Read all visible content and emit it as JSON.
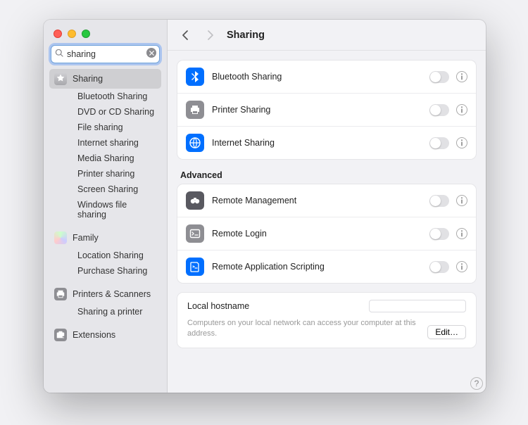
{
  "search": {
    "value": "sharing",
    "placeholder": "Search"
  },
  "sidebar": {
    "selected": "Sharing",
    "items": [
      "Bluetooth Sharing",
      "DVD or CD Sharing",
      "File sharing",
      "Internet sharing",
      "Media Sharing",
      "Printer sharing",
      "Screen Sharing",
      "Windows file sharing"
    ],
    "family": {
      "label": "Family",
      "items": [
        "Location Sharing",
        "Purchase Sharing"
      ]
    },
    "printers": {
      "label": "Printers & Scanners",
      "items": [
        "Sharing a printer"
      ]
    },
    "extensions": {
      "label": "Extensions"
    }
  },
  "main": {
    "title": "Sharing",
    "rows": [
      {
        "label": "Bluetooth Sharing",
        "icon": "bluetooth",
        "bg": "bg-blue"
      },
      {
        "label": "Printer Sharing",
        "icon": "printer",
        "bg": "bg-gray"
      },
      {
        "label": "Internet Sharing",
        "icon": "globe",
        "bg": "bg-blue"
      }
    ],
    "advanced_label": "Advanced",
    "advanced_rows": [
      {
        "label": "Remote Management",
        "icon": "binoculars",
        "bg": "bg-darkgray"
      },
      {
        "label": "Remote Login",
        "icon": "terminal",
        "bg": "bg-gray"
      },
      {
        "label": "Remote Application Scripting",
        "icon": "script",
        "bg": "bg-blue"
      }
    ],
    "hostname": {
      "title": "Local hostname",
      "value": "",
      "desc": "Computers on your local network can access your computer at this address.",
      "edit": "Edit…"
    },
    "help": "?"
  }
}
